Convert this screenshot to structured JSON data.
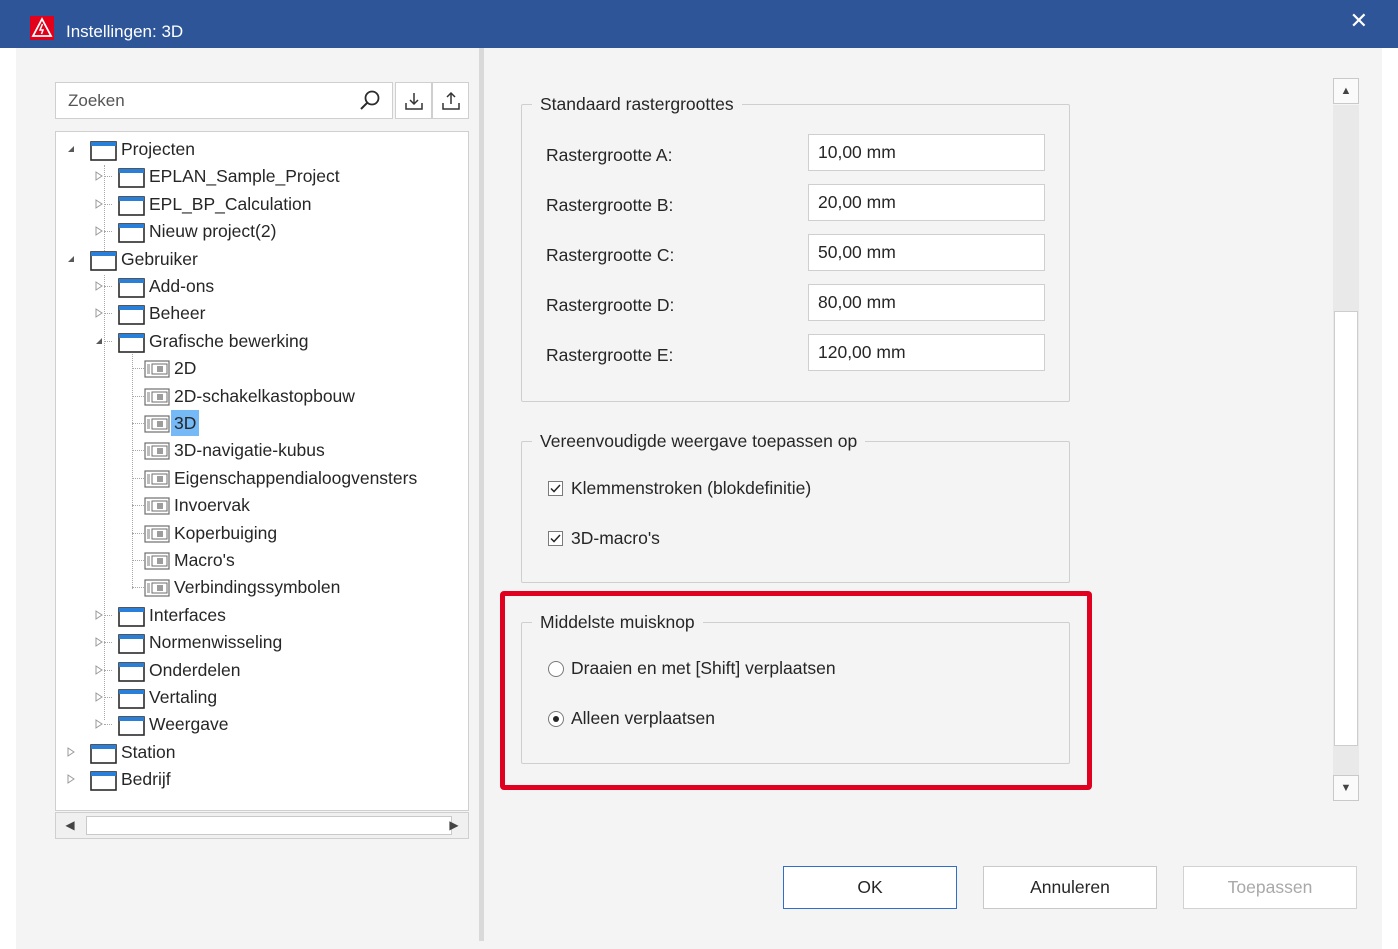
{
  "window": {
    "title": "Instellingen: 3D",
    "close_glyph": "✕"
  },
  "left": {
    "search": {
      "placeholder": "Zoeken"
    },
    "tree": [
      {
        "label": "Projecten",
        "type": "folder",
        "level": 0,
        "expanded": true
      },
      {
        "label": "EPLAN_Sample_Project",
        "type": "folder",
        "level": 1,
        "expanded": false
      },
      {
        "label": "EPL_BP_Calculation",
        "type": "folder",
        "level": 1,
        "expanded": false
      },
      {
        "label": "Nieuw project(2)",
        "type": "folder",
        "level": 1,
        "expanded": false
      },
      {
        "label": "Gebruiker",
        "type": "folder",
        "level": 0,
        "expanded": true
      },
      {
        "label": "Add-ons",
        "type": "folder",
        "level": 1,
        "expanded": false
      },
      {
        "label": "Beheer",
        "type": "folder",
        "level": 1,
        "expanded": false
      },
      {
        "label": "Grafische bewerking",
        "type": "folder",
        "level": 1,
        "expanded": true
      },
      {
        "label": "2D",
        "type": "doc",
        "level": 2
      },
      {
        "label": "2D-schakelkastopbouw",
        "type": "doc",
        "level": 2
      },
      {
        "label": "3D",
        "type": "doc",
        "level": 2,
        "selected": true
      },
      {
        "label": "3D-navigatie-kubus",
        "type": "doc",
        "level": 2
      },
      {
        "label": "Eigenschappendialoogvensters",
        "type": "doc",
        "level": 2
      },
      {
        "label": "Invoervak",
        "type": "doc",
        "level": 2
      },
      {
        "label": "Koperbuiging",
        "type": "doc",
        "level": 2
      },
      {
        "label": "Macro's",
        "type": "doc",
        "level": 2
      },
      {
        "label": "Verbindingssymbolen",
        "type": "doc",
        "level": 2
      },
      {
        "label": "Interfaces",
        "type": "folder",
        "level": 1,
        "expanded": false
      },
      {
        "label": "Normenwisseling",
        "type": "folder",
        "level": 1,
        "expanded": false
      },
      {
        "label": "Onderdelen",
        "type": "folder",
        "level": 1,
        "expanded": false
      },
      {
        "label": "Vertaling",
        "type": "folder",
        "level": 1,
        "expanded": false
      },
      {
        "label": "Weergave",
        "type": "folder",
        "level": 1,
        "expanded": false
      },
      {
        "label": "Station",
        "type": "folder",
        "level": 0,
        "expanded": false
      },
      {
        "label": "Bedrijf",
        "type": "folder",
        "level": 0,
        "expanded": false
      }
    ]
  },
  "grid_group": {
    "title": "Standaard rastergroottes",
    "fields": [
      {
        "label": "Rastergrootte A:",
        "value": "10,00 mm"
      },
      {
        "label": "Rastergrootte B:",
        "value": "20,00 mm"
      },
      {
        "label": "Rastergrootte C:",
        "value": "50,00 mm"
      },
      {
        "label": "Rastergrootte D:",
        "value": "80,00 mm"
      },
      {
        "label": "Rastergrootte E:",
        "value": "120,00 mm"
      }
    ]
  },
  "simplified_group": {
    "title": "Vereenvoudigde weergave toepassen op",
    "options": [
      {
        "label": "Klemmenstroken (blokdefinitie)",
        "checked": true
      },
      {
        "label": "3D-macro's",
        "checked": true
      }
    ]
  },
  "mouse_group": {
    "title": "Middelste muisknop",
    "options": [
      {
        "label": "Draaien en met [Shift] verplaatsen",
        "selected": false
      },
      {
        "label": "Alleen verplaatsen",
        "selected": true
      }
    ],
    "highlight_color": "#e00020"
  },
  "buttons": {
    "ok": "OK",
    "cancel": "Annuleren",
    "apply": "Toepassen"
  },
  "colors": {
    "titlebar": "#2d5597",
    "selection": "#76b9f7",
    "logo": "#e2001a"
  }
}
